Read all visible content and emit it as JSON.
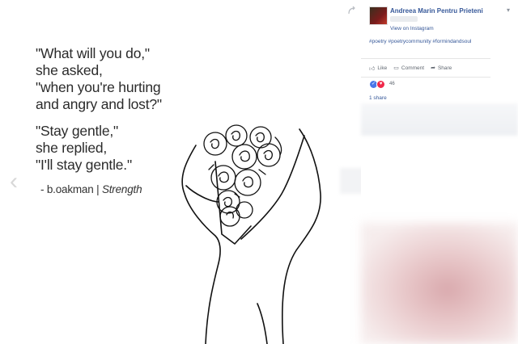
{
  "photo": {
    "quote_lines": [
      "\"What will you do,\"",
      "she asked,",
      "\"when you're hurting",
      "and angry and lost?\""
    ],
    "reply_lines": [
      "\"Stay gentle,\"",
      "she replied,",
      "\"I'll stay gentle.\""
    ],
    "signature_author": "- b.oakman |",
    "signature_title": "Strength",
    "prev_icon": "chevron-left-icon",
    "corner_icon": "share-arrow-icon"
  },
  "post": {
    "author": "Andreea Marin Pentru Prieteni",
    "view_link": "View on Instagram",
    "hashtags": "#poetry #poetrycommunity #formindandsoul",
    "actions": {
      "like": "Like",
      "comment": "Comment",
      "share": "Share"
    },
    "reactions_count": "46",
    "shares": "1 share",
    "colors": {
      "link": "#365899",
      "like": "#4a76e8",
      "love": "#f0284a"
    }
  }
}
